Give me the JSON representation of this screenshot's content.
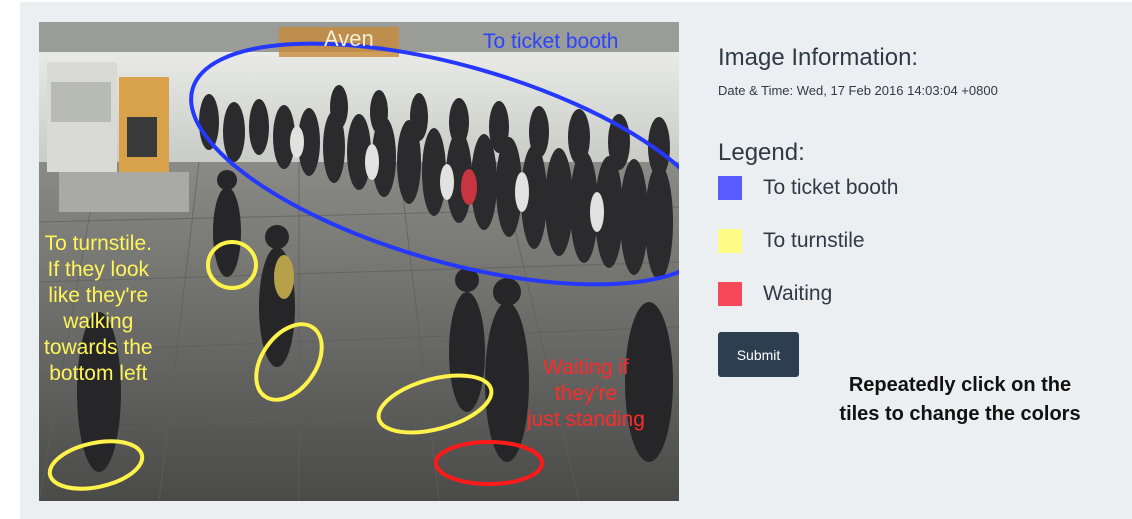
{
  "image_annotations": {
    "to_ticket_booth": "To ticket booth",
    "to_turnstile": "To turnstile.\nIf they look\nlike they're\nwalking\ntowards the\nbottom left",
    "waiting": "Waiting if\nthey're\njust standing",
    "sign_text": "Aven"
  },
  "info": {
    "title": "Image Information:",
    "datetime": "Date & Time: Wed, 17 Feb 2016 14:03:04 +0800"
  },
  "legend": {
    "title": "Legend:",
    "items": [
      {
        "label": "To ticket booth",
        "color": "#5a5cff"
      },
      {
        "label": "To turnstile",
        "color": "#fbfb86"
      },
      {
        "label": "Waiting",
        "color": "#f5495a"
      }
    ]
  },
  "submit_label": "Submit",
  "hint": "Repeatedly click on the tiles to change the colors",
  "colors": {
    "panel_bg": "#eceff1",
    "annotation_blue": "#2a44ff",
    "annotation_yellow": "#fff45a",
    "annotation_red": "#ff2a2a",
    "submit_bg": "#2c3e50"
  }
}
